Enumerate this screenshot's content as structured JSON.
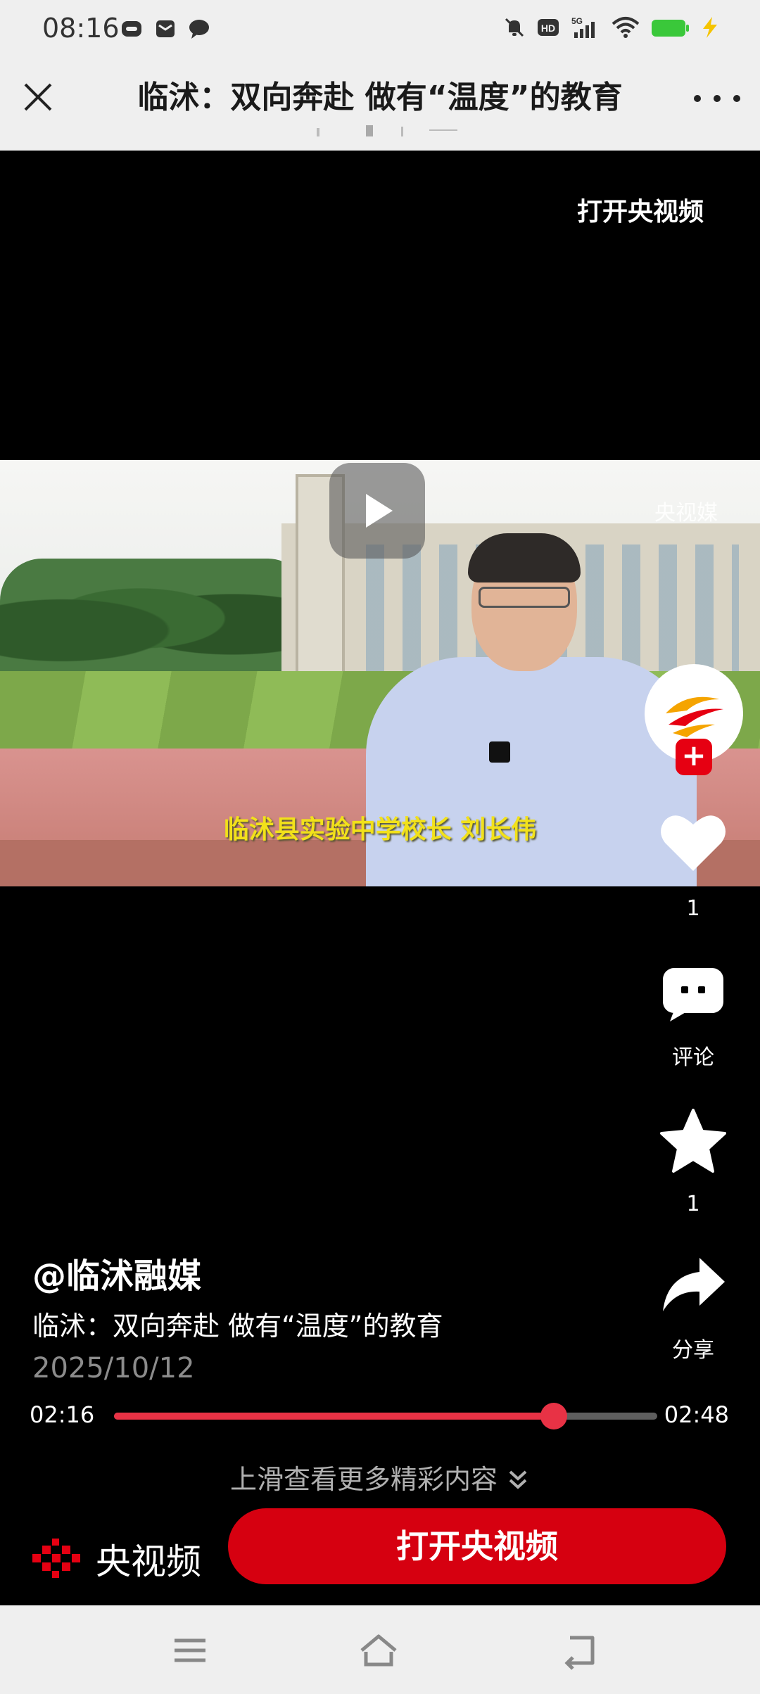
{
  "status_bar": {
    "time": "08:16",
    "network": "5G",
    "hd": "HD",
    "battery_color": "#3ac83a"
  },
  "title_bar": {
    "title": "临沭：双向奔赴 做有“温度”的教育"
  },
  "player": {
    "open_app_link": "打开央视频",
    "watermark": "央视媒",
    "subtitle": "临沭县实验中学校长  刘长伟"
  },
  "sidebar": {
    "like_count": "1",
    "comment_label": "评论",
    "favorite_count": "1",
    "share_label": "分享"
  },
  "info": {
    "author": "@临沭融媒",
    "description": "临沭：双向奔赴 做有“温度”的教育",
    "date": "2025/10/12"
  },
  "progress": {
    "current": "02:16",
    "total": "02:48",
    "fraction": 0.81
  },
  "swipe_hint": "上滑查看更多精彩内容",
  "brand": {
    "name": "央视频"
  },
  "cta": {
    "label": "打开央视频"
  },
  "colors": {
    "accent_red": "#d60010",
    "progress_red": "#e83245",
    "subtitle_yellow": "#f2e11a"
  }
}
